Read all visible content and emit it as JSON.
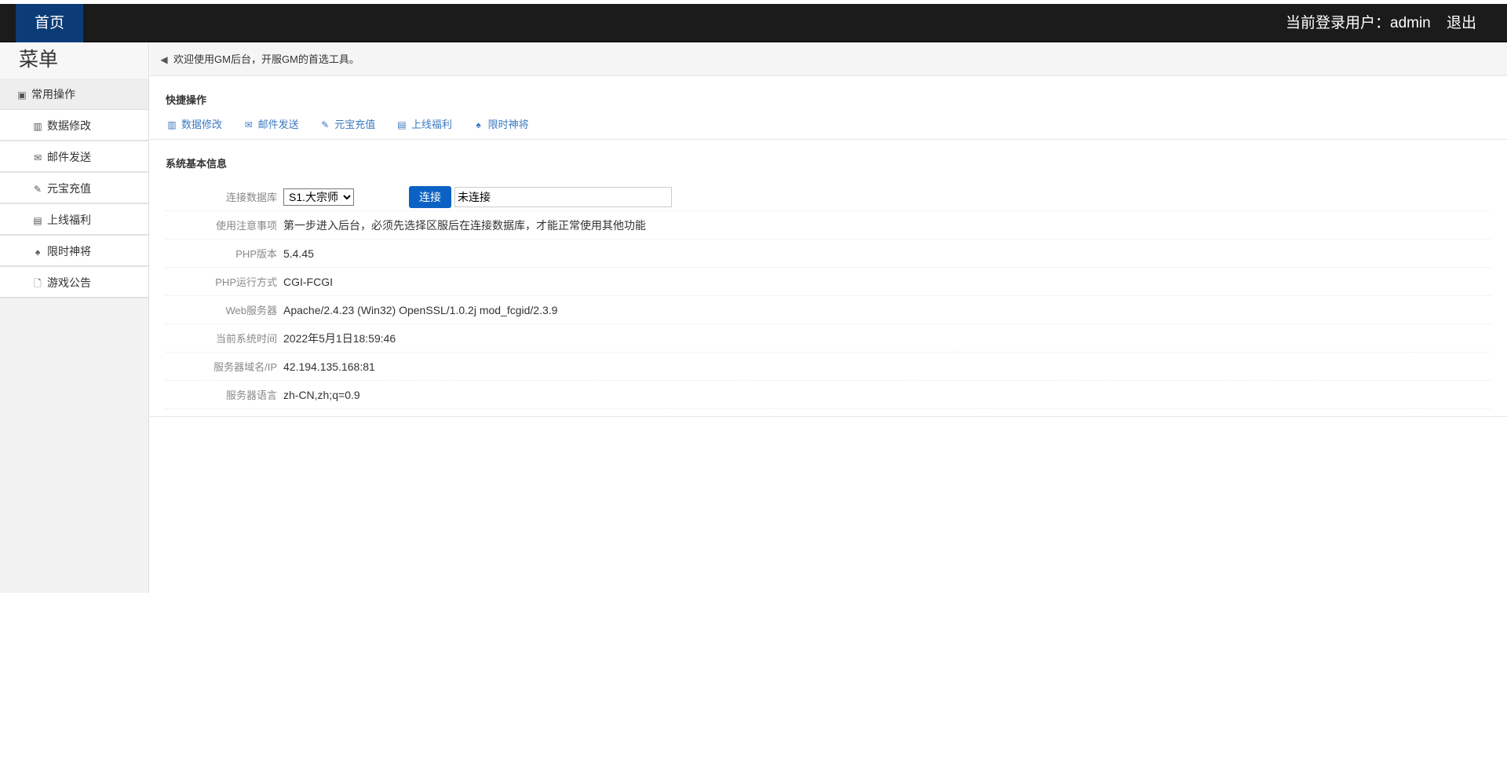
{
  "header": {
    "home": "首页",
    "user": "当前登录用户：admin",
    "logout": "退出"
  },
  "sidebar": {
    "title": "菜单",
    "group": "常用操作",
    "items": [
      {
        "label": "数据修改",
        "icon": "books-icon"
      },
      {
        "label": "邮件发送",
        "icon": "envelope-icon"
      },
      {
        "label": "元宝充值",
        "icon": "wrench-icon"
      },
      {
        "label": "上线福利",
        "icon": "list-icon"
      },
      {
        "label": "限时神将",
        "icon": "spade-icon"
      },
      {
        "label": "游戏公告",
        "icon": "file-icon"
      }
    ]
  },
  "notice": "欢迎使用GM后台，开服GM的首选工具。",
  "quick": {
    "title": "快捷操作",
    "links": [
      "数据修改",
      "邮件发送",
      "元宝充值",
      "上线福利",
      "限时神将"
    ]
  },
  "info": {
    "title": "系统基本信息",
    "db_label": "连接数据库",
    "db_selected": "S1.大宗师",
    "connect": "连接",
    "status": "未连接",
    "rows": [
      {
        "label": "使用注意事项",
        "value": "第一步进入后台，必须先选择区服后在连接数据库，才能正常使用其他功能"
      },
      {
        "label": "PHP版本",
        "value": "5.4.45"
      },
      {
        "label": "PHP运行方式",
        "value": "CGI-FCGI"
      },
      {
        "label": "Web服务器",
        "value": "Apache/2.4.23 (Win32) OpenSSL/1.0.2j mod_fcgid/2.3.9"
      },
      {
        "label": "当前系统时间",
        "value": "2022年5月1日18:59:46"
      },
      {
        "label": "服务器域名/IP",
        "value": "42.194.135.168:81"
      },
      {
        "label": "服务器语言",
        "value": "zh-CN,zh;q=0.9"
      }
    ]
  }
}
